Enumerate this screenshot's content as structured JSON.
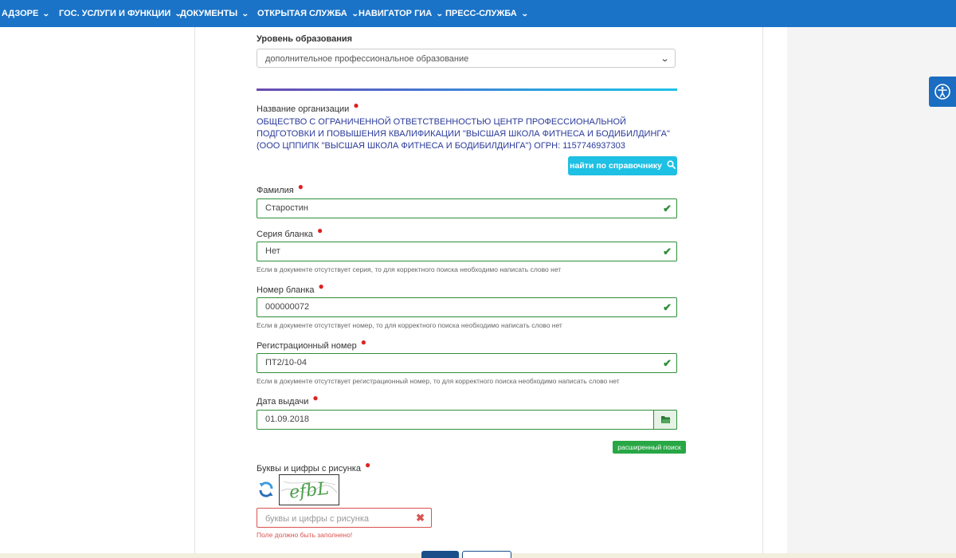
{
  "nav": {
    "items": [
      {
        "label": "АДЗОРЕ"
      },
      {
        "label": "ГОС. УСЛУГИ И ФУНКЦИИ"
      },
      {
        "label": "ДОКУМЕНТЫ"
      },
      {
        "label": "ОТКРЫТАЯ СЛУЖБА"
      },
      {
        "label": "НАВИГАТОР ГИА"
      },
      {
        "label": "ПРЕСС-СЛУЖБА"
      }
    ],
    "chevron": "chevron-down-icon",
    "bg_color": "#1a73c7"
  },
  "form": {
    "education_level": {
      "label": "Уровень образования",
      "value": "дополнительное профессиональное образование"
    },
    "organization": {
      "label": "Название организации",
      "value": "ОБЩЕСТВО С ОГРАНИЧЕННОЙ ОТВЕТСТВЕННОСТЬЮ ЦЕНТР ПРОФЕССИОНАЛЬНОЙ ПОДГОТОВКИ И ПОВЫШЕНИЯ КВАЛИФИКАЦИИ \"ВЫСШАЯ ШКОЛА ФИТНЕСА И БОДИБИЛДИНГА\" (ООО ЦППИПК \"ВЫСШАЯ ШКОЛА ФИТНЕСА И БОДИБИЛДИНГА\") ОГРН: 1157746937303",
      "find_button": "найти по справочнику"
    },
    "surname": {
      "label": "Фамилия",
      "value": "Старостин"
    },
    "series": {
      "label": "Серия бланка",
      "value": "Нет",
      "hint": "Если в документе отсутствует серия, то для корректного поиска необходимо написать слово нет"
    },
    "number": {
      "label": "Номер бланка",
      "value": "000000072",
      "hint": "Если в документе отсутствует номер, то для корректного поиска необходимо написать слово нет"
    },
    "reg_number": {
      "label": "Регистрационный номер",
      "value": "ПТ2/10-04",
      "hint": "Если в документе отсутствует регистрационный номер, то для корректного поиска необходимо написать слово нет"
    },
    "issue_date": {
      "label": "Дата выдачи",
      "value": "01.09.2018"
    },
    "advanced_search": "расширенный поиск",
    "captcha": {
      "label": "Буквы и цифры с рисунка",
      "placeholder": "буквы и цифры с рисунка",
      "error": "Поле должно быть заполнено!",
      "image_text": "efbL"
    }
  },
  "colors": {
    "valid": "#2e8f3a",
    "error": "#d9534f",
    "accent": "#1ec0e4",
    "org_text": "#2a3a9a"
  }
}
